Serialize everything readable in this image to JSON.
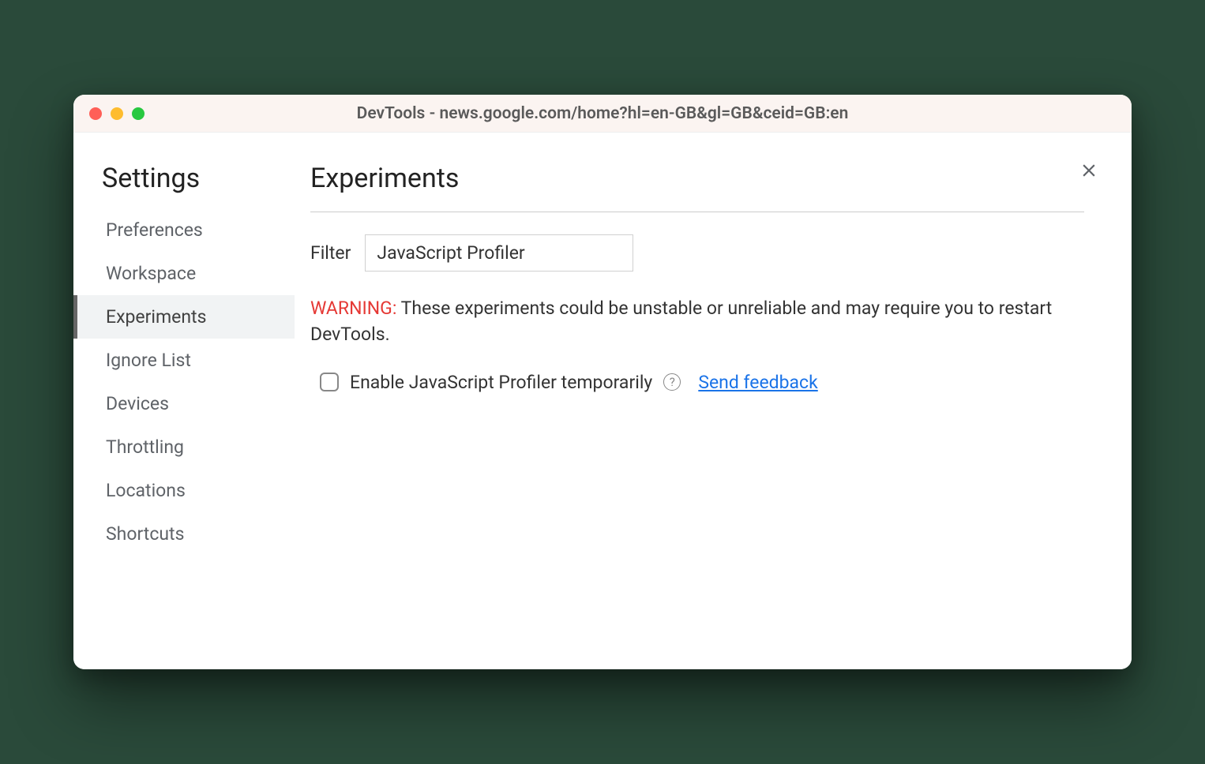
{
  "window": {
    "title": "DevTools - news.google.com/home?hl=en-GB&gl=GB&ceid=GB:en"
  },
  "sidebar": {
    "title": "Settings",
    "items": [
      {
        "label": "Preferences",
        "active": false
      },
      {
        "label": "Workspace",
        "active": false
      },
      {
        "label": "Experiments",
        "active": true
      },
      {
        "label": "Ignore List",
        "active": false
      },
      {
        "label": "Devices",
        "active": false
      },
      {
        "label": "Throttling",
        "active": false
      },
      {
        "label": "Locations",
        "active": false
      },
      {
        "label": "Shortcuts",
        "active": false
      }
    ]
  },
  "main": {
    "title": "Experiments",
    "filter_label": "Filter",
    "filter_value": "JavaScript Profiler",
    "warning_prefix": "WARNING:",
    "warning_text": " These experiments could be unstable or unreliable and may require you to restart DevTools.",
    "experiment": {
      "checked": false,
      "label": "Enable JavaScript Profiler temporarily",
      "help_glyph": "?",
      "feedback_label": "Send feedback"
    }
  }
}
